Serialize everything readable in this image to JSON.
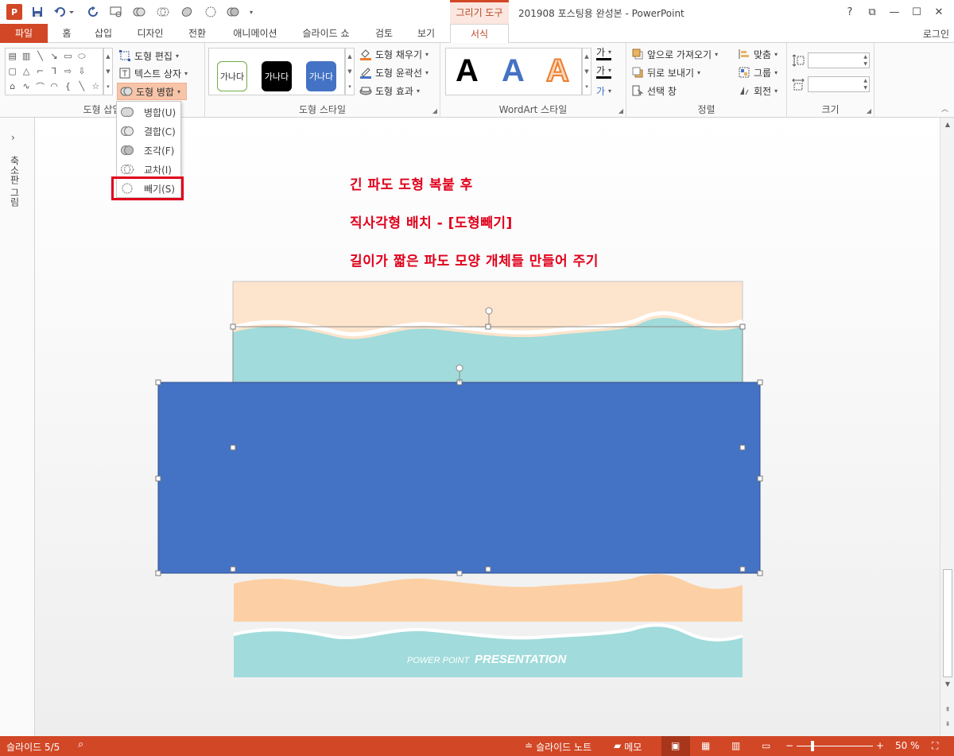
{
  "title_bar": {
    "app_icon": "P",
    "context_tab": "그리기 도구",
    "window_title": "201908 포스팅용 완성본 - PowerPoint",
    "qat_icons": [
      "save-icon",
      "undo-icon",
      "redo-icon",
      "slideshow-icon",
      "shape-union-icon",
      "shape-combine-icon",
      "shape-fragment-icon",
      "shape-intersect-icon",
      "shape-subtract-icon",
      "customize-icon"
    ],
    "help": "?",
    "restore": "⧉",
    "minimize": "—",
    "maximize": "☐",
    "close": "✕"
  },
  "tabs": {
    "file": "파일",
    "home": "홈",
    "insert": "삽입",
    "design": "디자인",
    "transitions": "전환",
    "animations": "애니메이션",
    "slideshow": "슬라이드 쇼",
    "review": "검토",
    "view": "보기",
    "format": "서식",
    "login": "로그인"
  },
  "ribbon": {
    "insert_shapes": {
      "label": "도형 삽입",
      "edit_shape": "도형 편집",
      "text_box": "텍스트 상자",
      "merge_shapes": "도형 병합"
    },
    "shape_styles": {
      "label": "도형 스타일",
      "samples": [
        "가나다",
        "가나다",
        "가나다"
      ],
      "fill": "도형 채우기",
      "outline": "도형 윤곽선",
      "effects": "도형 효과"
    },
    "wordart": {
      "label": "WordArt 스타일",
      "letters": [
        "A",
        "A",
        "A"
      ],
      "text_fill": "가",
      "text_outline": "가",
      "text_effect": "가"
    },
    "arrange": {
      "label": "정렬",
      "bring_forward": "앞으로 가져오기",
      "send_backward": "뒤로 보내기",
      "selection_pane": "선택 창",
      "align": "맞춤",
      "group": "그룹",
      "rotate": "회전"
    },
    "size": {
      "label": "크기",
      "height_value": "",
      "width_value": ""
    }
  },
  "merge_menu": {
    "items": [
      {
        "label": "병합(U)"
      },
      {
        "label": "결합(C)"
      },
      {
        "label": "조각(F)"
      },
      {
        "label": "교차(I)"
      },
      {
        "label": "빼기(S)"
      }
    ]
  },
  "thumbnails": {
    "label": "축소판 그림",
    "toggle": "›"
  },
  "slide": {
    "notes": [
      "긴 파도 도형 복붙 후",
      "직사각형 배치 - [도형빼기]",
      "길이가 짧은 파도 모양 개체들 만들어 주기"
    ],
    "footer_small": "POWER POINT",
    "footer_big": "PRESENTATION",
    "colors": {
      "peach": "#fde4cc",
      "teal": "#a1dbdb",
      "blue_rect": "#4472c4",
      "orange_wave": "#fcd0a4",
      "annotation_red": "#e0001b"
    }
  },
  "status_bar": {
    "slide_count": "슬라이드 5/5",
    "notes": "슬라이드 노트",
    "comments": "메모",
    "zoom": "50 %"
  }
}
